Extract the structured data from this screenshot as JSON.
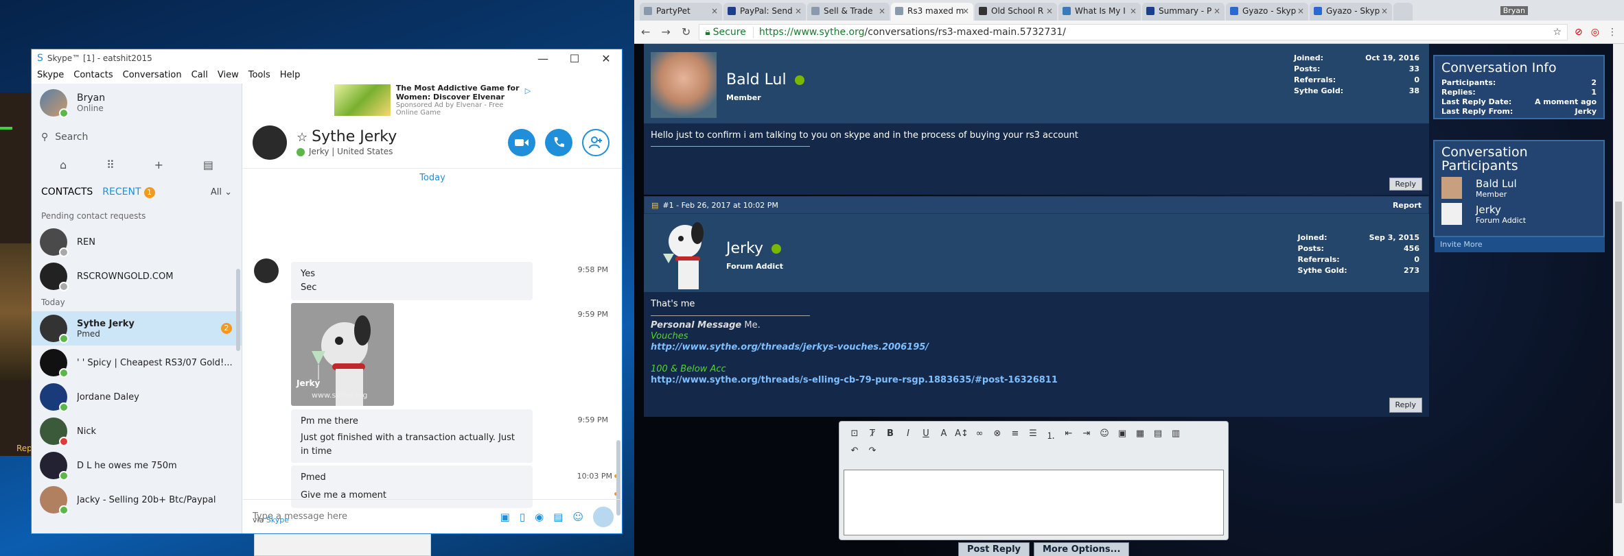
{
  "desktop": {
    "left_app_text": "Rep"
  },
  "skype": {
    "title": "Skype™ [1] - eatshit2015",
    "menu": [
      "Skype",
      "Contacts",
      "Conversation",
      "Call",
      "View",
      "Tools",
      "Help"
    ],
    "profile": {
      "name": "Bryan",
      "status": "Online"
    },
    "search_placeholder": "Search",
    "tabs": {
      "contacts": "CONTACTS",
      "recent": "RECENT",
      "recent_badge": "1",
      "filter": "All"
    },
    "pending_label": "Pending contact requests",
    "pending": [
      "REN",
      "RSCROWNGOLD.COM"
    ],
    "today_label": "Today",
    "contacts": [
      {
        "name": "Sythe Jerky",
        "sub": "Pmed",
        "badge": "2",
        "status": "online"
      },
      {
        "name": "' ' Spicy | Cheapest RS3/07 Gold!...",
        "sub": "",
        "status": "online"
      },
      {
        "name": "Jordane Daley",
        "sub": "",
        "status": "online"
      },
      {
        "name": "Nick",
        "sub": "",
        "status": "busy"
      },
      {
        "name": "D L he owes me 750m",
        "sub": "",
        "status": "online"
      },
      {
        "name": "Jacky - Selling 20b+ Btc/Paypal",
        "sub": "",
        "status": "online"
      }
    ],
    "ad": {
      "title": "The Most Addictive Game for Women: Discover Elvenar",
      "sponsor": "Sponsored Ad by Elvenar - Free Online Game"
    },
    "chat": {
      "name": "Sythe Jerky",
      "sub": "Jerky | United States",
      "day_label": "Today",
      "messages": [
        {
          "lines": [
            "Yes",
            "Sec"
          ],
          "time": "9:58 PM"
        },
        {
          "image_title": "Jerky",
          "image_site": "www.sythe.org",
          "time": "9:59 PM"
        },
        {
          "lines": [
            "Pm me there",
            "Just got finished with a transaction actually. Just in time"
          ],
          "time": "9:59 PM"
        },
        {
          "lines": [
            "Pmed",
            "Give me a moment"
          ],
          "time": "10:03 PM"
        }
      ],
      "via_prefix": "via",
      "via_link": "Skype",
      "input_placeholder": "Type a message here"
    }
  },
  "browser": {
    "tabs": [
      "PartyPet",
      "PayPal: Send",
      "Sell & Trade",
      "Rs3 maxed m",
      "Old School R",
      "What Is My I",
      "Summary - P",
      "Gyazo - Skyp",
      "Gyazo - Skyp"
    ],
    "active_tab": 3,
    "user_badge": "Bryan",
    "secure_label": "Secure",
    "url_prefix": "https://www.sythe.org",
    "url_path": "/conversations/rs3-maxed-main.5732731/",
    "posts": [
      {
        "username": "Bald Lul",
        "role": "Member",
        "stats": [
          [
            "Joined:",
            "Oct 19, 2016"
          ],
          [
            "Posts:",
            "33"
          ],
          [
            "Referrals:",
            "0"
          ],
          [
            "Sythe Gold:",
            "38"
          ]
        ],
        "body": "Hello just to confirm i am talking to you on skype and in the process of buying your rs3 account",
        "reply": "Reply"
      },
      {
        "header": "#1 - Feb 26, 2017 at 10:02 PM",
        "report": "Report",
        "username": "Jerky",
        "role": "Forum Addict",
        "stats": [
          [
            "Joined:",
            "Sep 3, 2015"
          ],
          [
            "Posts:",
            "456"
          ],
          [
            "Referrals:",
            "0"
          ],
          [
            "Sythe Gold:",
            "273"
          ]
        ],
        "body": "That's me",
        "sig_label": "Personal Message",
        "sig_value": "Me.",
        "vouches": "Vouches",
        "vouch_link": "http://www.sythe.org/threads/jerkys-vouches.2006195/",
        "acc": "100 & Below Acc",
        "acc_link": "http://www.sythe.org/threads/s-elling-cb-79-pure-rsgp.1883635/#post-16326811",
        "reply": "Reply"
      }
    ],
    "sidebar": {
      "info_title": "Conversation Info",
      "info": [
        [
          "Participants:",
          "2"
        ],
        [
          "Replies:",
          "1"
        ],
        [
          "Last Reply Date:",
          "A moment ago"
        ],
        [
          "Last Reply From:",
          "Jerky"
        ]
      ],
      "participants_title": "Conversation Participants",
      "participants": [
        {
          "name": "Bald Lul",
          "role": "Member"
        },
        {
          "name": "Jerky",
          "role": "Forum Addict"
        }
      ],
      "invite": "Invite More"
    },
    "buttons": {
      "post_reply": "Post Reply",
      "more_options": "More Options..."
    }
  }
}
